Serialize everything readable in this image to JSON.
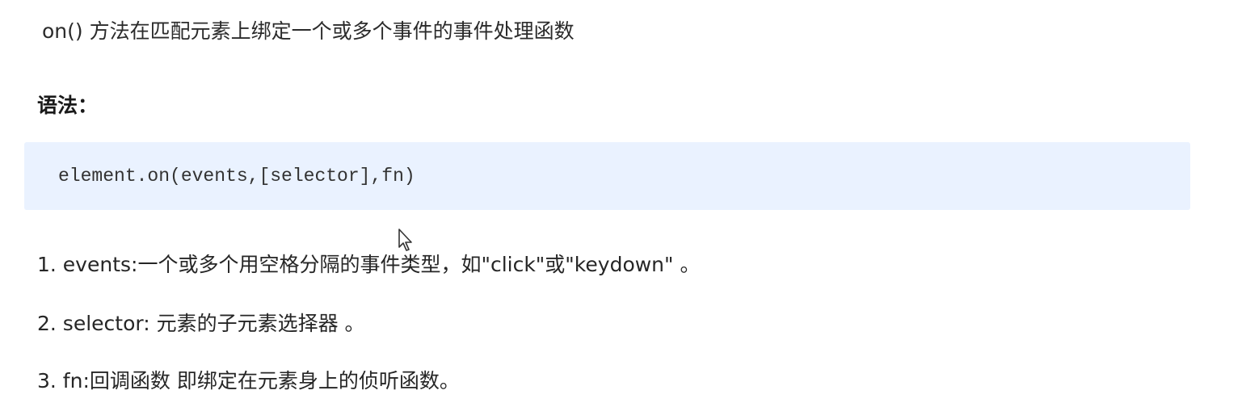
{
  "intro_text": "on() 方法在匹配元素上绑定一个或多个事件的事件处理函数",
  "syntax": {
    "heading": "语法：",
    "code": "element.on(events,[selector],fn)"
  },
  "parameters": [
    {
      "text": "1. events:一个或多个用空格分隔的事件类型，如\"click\"或\"keydown\" 。"
    },
    {
      "text": "2. selector: 元素的子元素选择器 。"
    },
    {
      "text": "3. fn:回调函数 即绑定在元素身上的侦听函数。"
    }
  ],
  "icons": {
    "cursor": "mouse-pointer-icon"
  },
  "colors": {
    "code_background": "#eaf2ff",
    "text": "#262626"
  }
}
